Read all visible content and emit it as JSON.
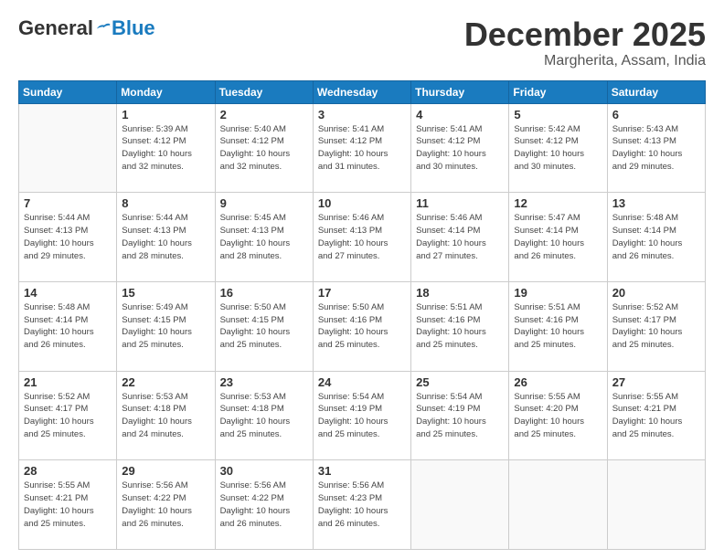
{
  "header": {
    "logo_general": "General",
    "logo_blue": "Blue",
    "month": "December 2025",
    "location": "Margherita, Assam, India"
  },
  "days_of_week": [
    "Sunday",
    "Monday",
    "Tuesday",
    "Wednesday",
    "Thursday",
    "Friday",
    "Saturday"
  ],
  "weeks": [
    [
      {
        "day": "",
        "info": ""
      },
      {
        "day": "1",
        "info": "Sunrise: 5:39 AM\nSunset: 4:12 PM\nDaylight: 10 hours\nand 32 minutes."
      },
      {
        "day": "2",
        "info": "Sunrise: 5:40 AM\nSunset: 4:12 PM\nDaylight: 10 hours\nand 32 minutes."
      },
      {
        "day": "3",
        "info": "Sunrise: 5:41 AM\nSunset: 4:12 PM\nDaylight: 10 hours\nand 31 minutes."
      },
      {
        "day": "4",
        "info": "Sunrise: 5:41 AM\nSunset: 4:12 PM\nDaylight: 10 hours\nand 30 minutes."
      },
      {
        "day": "5",
        "info": "Sunrise: 5:42 AM\nSunset: 4:12 PM\nDaylight: 10 hours\nand 30 minutes."
      },
      {
        "day": "6",
        "info": "Sunrise: 5:43 AM\nSunset: 4:13 PM\nDaylight: 10 hours\nand 29 minutes."
      }
    ],
    [
      {
        "day": "7",
        "info": "Sunrise: 5:44 AM\nSunset: 4:13 PM\nDaylight: 10 hours\nand 29 minutes."
      },
      {
        "day": "8",
        "info": "Sunrise: 5:44 AM\nSunset: 4:13 PM\nDaylight: 10 hours\nand 28 minutes."
      },
      {
        "day": "9",
        "info": "Sunrise: 5:45 AM\nSunset: 4:13 PM\nDaylight: 10 hours\nand 28 minutes."
      },
      {
        "day": "10",
        "info": "Sunrise: 5:46 AM\nSunset: 4:13 PM\nDaylight: 10 hours\nand 27 minutes."
      },
      {
        "day": "11",
        "info": "Sunrise: 5:46 AM\nSunset: 4:14 PM\nDaylight: 10 hours\nand 27 minutes."
      },
      {
        "day": "12",
        "info": "Sunrise: 5:47 AM\nSunset: 4:14 PM\nDaylight: 10 hours\nand 26 minutes."
      },
      {
        "day": "13",
        "info": "Sunrise: 5:48 AM\nSunset: 4:14 PM\nDaylight: 10 hours\nand 26 minutes."
      }
    ],
    [
      {
        "day": "14",
        "info": "Sunrise: 5:48 AM\nSunset: 4:14 PM\nDaylight: 10 hours\nand 26 minutes."
      },
      {
        "day": "15",
        "info": "Sunrise: 5:49 AM\nSunset: 4:15 PM\nDaylight: 10 hours\nand 25 minutes."
      },
      {
        "day": "16",
        "info": "Sunrise: 5:50 AM\nSunset: 4:15 PM\nDaylight: 10 hours\nand 25 minutes."
      },
      {
        "day": "17",
        "info": "Sunrise: 5:50 AM\nSunset: 4:16 PM\nDaylight: 10 hours\nand 25 minutes."
      },
      {
        "day": "18",
        "info": "Sunrise: 5:51 AM\nSunset: 4:16 PM\nDaylight: 10 hours\nand 25 minutes."
      },
      {
        "day": "19",
        "info": "Sunrise: 5:51 AM\nSunset: 4:16 PM\nDaylight: 10 hours\nand 25 minutes."
      },
      {
        "day": "20",
        "info": "Sunrise: 5:52 AM\nSunset: 4:17 PM\nDaylight: 10 hours\nand 25 minutes."
      }
    ],
    [
      {
        "day": "21",
        "info": "Sunrise: 5:52 AM\nSunset: 4:17 PM\nDaylight: 10 hours\nand 25 minutes."
      },
      {
        "day": "22",
        "info": "Sunrise: 5:53 AM\nSunset: 4:18 PM\nDaylight: 10 hours\nand 24 minutes."
      },
      {
        "day": "23",
        "info": "Sunrise: 5:53 AM\nSunset: 4:18 PM\nDaylight: 10 hours\nand 25 minutes."
      },
      {
        "day": "24",
        "info": "Sunrise: 5:54 AM\nSunset: 4:19 PM\nDaylight: 10 hours\nand 25 minutes."
      },
      {
        "day": "25",
        "info": "Sunrise: 5:54 AM\nSunset: 4:19 PM\nDaylight: 10 hours\nand 25 minutes."
      },
      {
        "day": "26",
        "info": "Sunrise: 5:55 AM\nSunset: 4:20 PM\nDaylight: 10 hours\nand 25 minutes."
      },
      {
        "day": "27",
        "info": "Sunrise: 5:55 AM\nSunset: 4:21 PM\nDaylight: 10 hours\nand 25 minutes."
      }
    ],
    [
      {
        "day": "28",
        "info": "Sunrise: 5:55 AM\nSunset: 4:21 PM\nDaylight: 10 hours\nand 25 minutes."
      },
      {
        "day": "29",
        "info": "Sunrise: 5:56 AM\nSunset: 4:22 PM\nDaylight: 10 hours\nand 26 minutes."
      },
      {
        "day": "30",
        "info": "Sunrise: 5:56 AM\nSunset: 4:22 PM\nDaylight: 10 hours\nand 26 minutes."
      },
      {
        "day": "31",
        "info": "Sunrise: 5:56 AM\nSunset: 4:23 PM\nDaylight: 10 hours\nand 26 minutes."
      },
      {
        "day": "",
        "info": ""
      },
      {
        "day": "",
        "info": ""
      },
      {
        "day": "",
        "info": ""
      }
    ]
  ]
}
